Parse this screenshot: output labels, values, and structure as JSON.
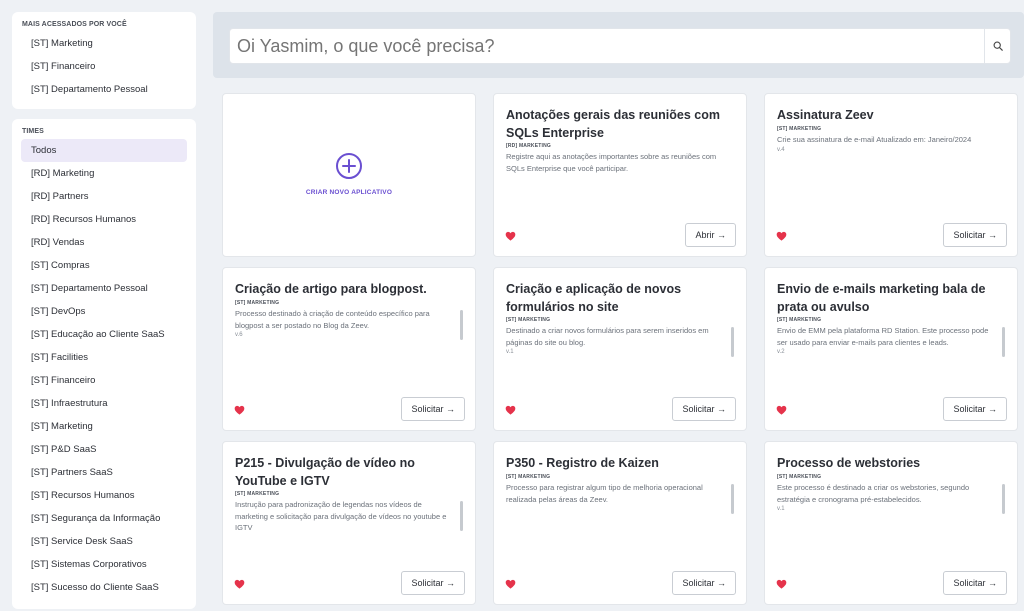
{
  "most_accessed": {
    "title": "MAIS ACESSADOS POR VOCÊ",
    "items": [
      "[ST] Marketing",
      "[ST] Financeiro",
      "[ST] Departamento Pessoal"
    ]
  },
  "teams": {
    "title": "TIMES",
    "items": [
      "Todos",
      "[RD] Marketing",
      "[RD] Partners",
      "[RD] Recursos Humanos",
      "[RD] Vendas",
      "[ST] Compras",
      "[ST] Departamento Pessoal",
      "[ST] DevOps",
      "[ST] Educação ao Cliente SaaS",
      "[ST] Facilities",
      "[ST] Financeiro",
      "[ST] Infraestrutura",
      "[ST] Marketing",
      "[ST] P&D SaaS",
      "[ST] Partners SaaS",
      "[ST] Recursos Humanos",
      "[ST] Segurança da Informação",
      "[ST] Service Desk SaaS",
      "[ST] Sistemas Corporativos",
      "[ST] Sucesso do Cliente SaaS"
    ],
    "active_index": 0
  },
  "search": {
    "placeholder": "Oi Yasmim, o que você precisa?"
  },
  "create": {
    "label": "CRIAR NOVO APLICATIVO"
  },
  "colors": {
    "accent": "#6a4fd1",
    "heart": "#e5334b"
  },
  "cards": [
    {
      "title": "Anotações gerais das reuniões com SQLs Enterprise",
      "team": "[RD] MARKETING",
      "description": "Registre aqui as anotações importantes sobre as reuniões com SQLs Enterprise que você participar.",
      "version": "",
      "action": "Abrir →"
    },
    {
      "title": "Assinatura Zeev",
      "team": "[ST] MARKETING",
      "description": "Crie sua assinatura de e-mail Atualizado em: Janeiro/2024",
      "version": "v.4",
      "action": "Solicitar →"
    },
    {
      "title": "Criação de artigo para blogpost.",
      "team": "[ST] MARKETING",
      "description": "Processo destinado à criação de conteúdo específico para blogpost a ser postado no Blog da Zeev.",
      "version": "v.6",
      "action": "Solicitar →"
    },
    {
      "title": "Criação e aplicação de novos formulários no site",
      "team": "[ST] MARKETING",
      "description": "Destinado a criar novos formulários para serem inseridos em páginas do site ou blog.",
      "version": "v.1",
      "action": "Solicitar →"
    },
    {
      "title": "Envio de e-mails marketing bala de prata ou avulso",
      "team": "[ST] MARKETING",
      "description": "Envio de EMM pela plataforma RD Station. Este processo pode ser usado para enviar e-mails para clientes e leads.",
      "version": "v.2",
      "action": "Solicitar →"
    },
    {
      "title": "P215 - Divulgação de vídeo no YouTube e IGTV",
      "team": "[ST] MARKETING",
      "description": "Instrução para padronização de legendas nos vídeos de marketing e solicitação para divulgação de vídeos no youtube e IGTV",
      "version": "",
      "action": "Solicitar →"
    },
    {
      "title": "P350 - Registro de Kaizen",
      "team": "[ST] MARKETING",
      "description": "Processo para registrar algum tipo de melhoria operacional realizada pelas áreas da Zeev.",
      "version": "",
      "action": "Solicitar →"
    },
    {
      "title": "Processo de webstories",
      "team": "[ST] MARKETING",
      "description": "Este processo é destinado a criar os webstories, segundo estratégia e cronograma pré-estabelecidos.",
      "version": "v.1",
      "action": "Solicitar →"
    }
  ]
}
